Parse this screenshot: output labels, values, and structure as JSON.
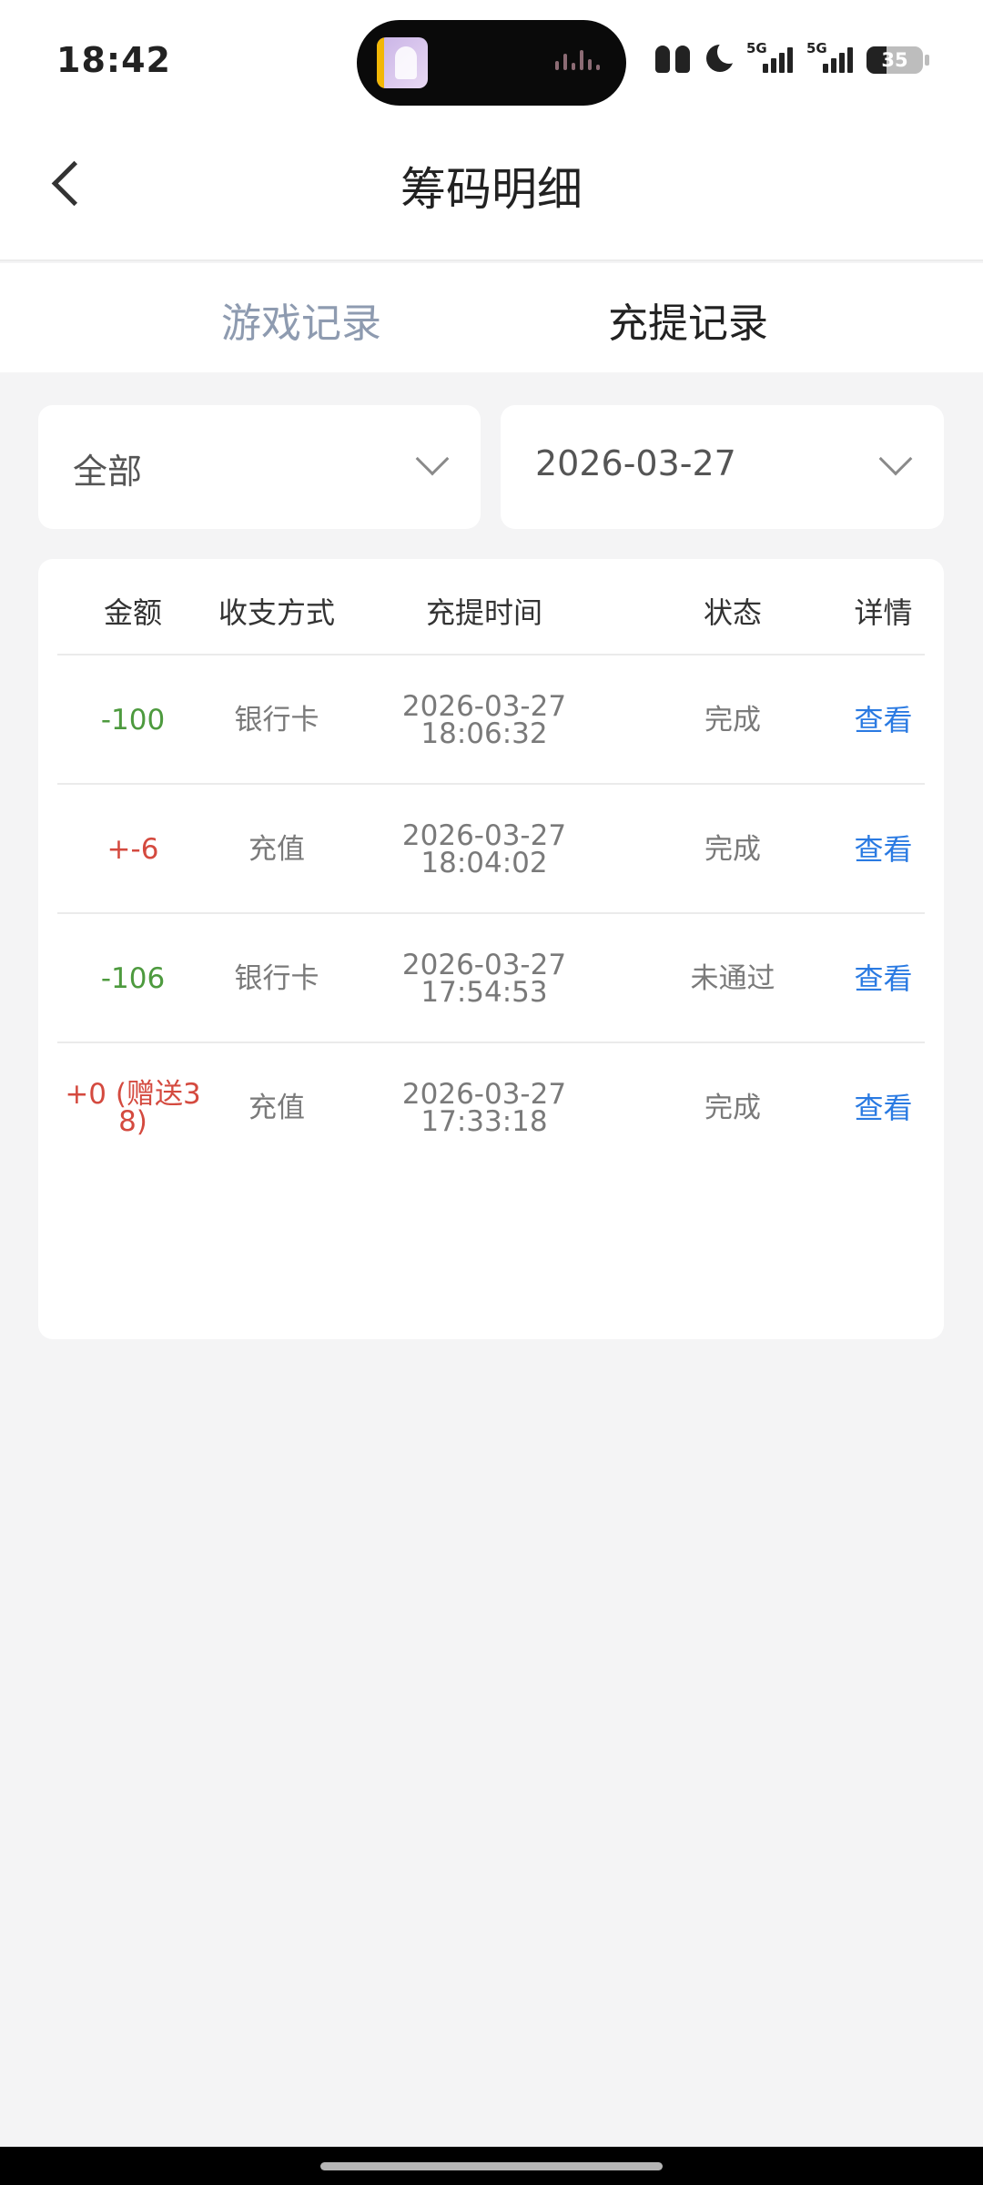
{
  "status_bar": {
    "time": "18:42",
    "signal_label_1": "5G",
    "signal_label_2": "5G",
    "battery_percent": "35"
  },
  "header": {
    "title": "筹码明细"
  },
  "tabs": [
    {
      "label": "游戏记录",
      "active": false
    },
    {
      "label": "充提记录",
      "active": true
    }
  ],
  "filters": {
    "type_value": "全部",
    "date_value": "2026-03-27"
  },
  "table": {
    "columns": [
      "金额",
      "收支方式",
      "充提时间",
      "状态",
      "详情"
    ],
    "rows": [
      {
        "amount": "-100",
        "method": "银行卡",
        "date": "2026-03-27",
        "time": "18:06:32",
        "status": "完成",
        "detail": "查看"
      },
      {
        "amount": "+-6",
        "method": "充值",
        "date": "2026-03-27",
        "time": "18:04:02",
        "status": "完成",
        "detail": "查看"
      },
      {
        "amount": "-106",
        "method": "银行卡",
        "date": "2026-03-27",
        "time": "17:54:53",
        "status": "未通过",
        "detail": "查看"
      },
      {
        "amount_line1": "+0 (赠送3",
        "amount_line2": "8)",
        "method": "充值",
        "date": "2026-03-27",
        "time": "17:33:18",
        "status": "完成",
        "detail": "查看"
      }
    ]
  },
  "colors": {
    "negative_amount": "#4d9a3e",
    "positive_amount": "#d44a3f",
    "link": "#2a7ae2",
    "inactive_tab": "#8e9bb0"
  }
}
